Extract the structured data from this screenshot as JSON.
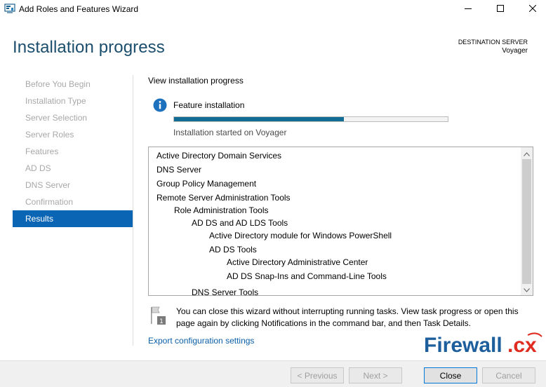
{
  "window": {
    "title": "Add Roles and Features Wizard",
    "controls": [
      "minimize",
      "maximize",
      "close"
    ]
  },
  "header": {
    "page_title": "Installation progress",
    "destination_label": "DESTINATION SERVER",
    "destination_value": "Voyager"
  },
  "nav": {
    "items": [
      {
        "label": "Before You Begin",
        "state": "disabled"
      },
      {
        "label": "Installation Type",
        "state": "disabled"
      },
      {
        "label": "Server Selection",
        "state": "disabled"
      },
      {
        "label": "Server Roles",
        "state": "disabled"
      },
      {
        "label": "Features",
        "state": "disabled"
      },
      {
        "label": "AD DS",
        "state": "disabled"
      },
      {
        "label": "DNS Server",
        "state": "disabled"
      },
      {
        "label": "Confirmation",
        "state": "disabled"
      },
      {
        "label": "Results",
        "state": "active"
      }
    ]
  },
  "main": {
    "heading": "View installation progress",
    "feature_label": "Feature installation",
    "progress": 0.62,
    "status_text": "Installation started on Voyager",
    "results": [
      {
        "text": "Active Directory Domain Services",
        "level": 0
      },
      {
        "text": "DNS Server",
        "level": 0
      },
      {
        "text": "Group Policy Management",
        "level": 0
      },
      {
        "text": "Remote Server Administration Tools",
        "level": 0
      },
      {
        "text": "Role Administration Tools",
        "level": 1
      },
      {
        "text": "AD DS and AD LDS Tools",
        "level": 2
      },
      {
        "text": "Active Directory module for Windows PowerShell",
        "level": 3
      },
      {
        "text": "AD DS Tools",
        "level": 3
      },
      {
        "text": "Active Directory Administrative Center",
        "level": 4
      },
      {
        "text": "AD DS Snap-Ins and Command-Line Tools",
        "level": 4
      },
      {
        "text": "DNS Server Tools",
        "level": 2
      }
    ],
    "note": "You can close this wizard without interrupting running tasks. View task progress or open this page again by clicking Notifications in the command bar, and then Task Details.",
    "export_link": "Export configuration settings"
  },
  "footer": {
    "previous": "< Previous",
    "next": "Next >",
    "close": "Close",
    "cancel": "Cancel"
  },
  "watermark": {
    "text_main": "Firewall",
    "text_suffix": ".cx"
  },
  "colors": {
    "accent": "#0a66b4",
    "title": "#1b4d6d",
    "progress": "#126d95",
    "link": "#0a5fa8"
  }
}
